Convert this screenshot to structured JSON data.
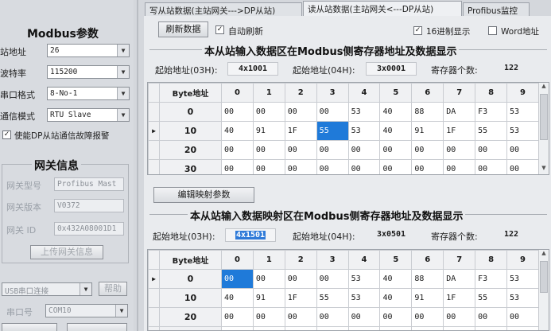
{
  "tabs": [
    {
      "label": "写从站数据(主站网关--->DP从站)"
    },
    {
      "label": "读从站数据(主站网关<---DP从站)"
    },
    {
      "label": "Profibus监控"
    }
  ],
  "modbus_params": {
    "title": "Modbus参数",
    "fields": [
      {
        "label": "站地址",
        "value": "26"
      },
      {
        "label": "波特率",
        "value": "115200"
      },
      {
        "label": "串口格式",
        "value": "8-No-1"
      },
      {
        "label": "通信模式",
        "value": "RTU Slave"
      }
    ],
    "alarm_checkbox": {
      "checked": true,
      "label": "使能DP从站通信故障报警"
    }
  },
  "gateway_info": {
    "title": "网关信息",
    "fields": [
      {
        "label": "网关型号",
        "value": "Profibus Mast"
      },
      {
        "label": "网关版本",
        "value": "V0372"
      },
      {
        "label": "网关 ID",
        "value": "0x432A08001D1"
      }
    ],
    "upload_button": "上传网关信息"
  },
  "connection": {
    "type_value": "USB串口连接",
    "help_button": "帮助",
    "port_label": "串口号",
    "port_value": "COM10"
  },
  "toolbar": {
    "refresh_button": "刷新数据",
    "auto_refresh": {
      "checked": true,
      "label": "自动刷新"
    },
    "hex_display": {
      "checked": true,
      "label": "16进制显示"
    },
    "word_address": {
      "checked": false,
      "label": "Word地址"
    }
  },
  "input_section": {
    "title": "本从站输入数据区在Modbus侧寄存器地址及数据显示",
    "start_03h_label": "起始地址(03H):",
    "start_03h_value": "4x1001",
    "start_04h_label": "起始地址(04H):",
    "start_04h_value": "3x0001",
    "reg_count_label": "寄存器个数:",
    "reg_count_value": "122",
    "grid": {
      "header": [
        "Byte地址",
        "0",
        "1",
        "2",
        "3",
        "4",
        "5",
        "6",
        "7",
        "8",
        "9"
      ],
      "rows": [
        {
          "addr": "0",
          "marker": "",
          "cells": [
            "00",
            "00",
            "00",
            "00",
            "53",
            "40",
            "88",
            "DA",
            "F3",
            "53"
          ]
        },
        {
          "addr": "10",
          "marker": "▶",
          "cells": [
            "40",
            "91",
            "1F",
            "55",
            "53",
            "40",
            "91",
            "1F",
            "55",
            "53"
          ]
        },
        {
          "addr": "20",
          "marker": "",
          "cells": [
            "00",
            "00",
            "00",
            "00",
            "00",
            "00",
            "00",
            "00",
            "00",
            "00"
          ]
        },
        {
          "addr": "30",
          "marker": "",
          "cells": [
            "00",
            "00",
            "00",
            "00",
            "00",
            "00",
            "00",
            "00",
            "00",
            "00"
          ]
        }
      ]
    }
  },
  "edit_mapping_button": "编辑映射参数",
  "mapping_section": {
    "title": "本从站输入数据映射区在Modbus侧寄存器地址及数据显示",
    "start_03h_label": "起始地址(03H):",
    "start_03h_value": "4x1501",
    "start_04h_label": "起始地址(04H):",
    "start_04h_value": "3x0501",
    "reg_count_label": "寄存器个数:",
    "reg_count_value": "122",
    "grid": {
      "header": [
        "Byte地址",
        "0",
        "1",
        "2",
        "3",
        "4",
        "5",
        "6",
        "7",
        "8",
        "9"
      ],
      "rows": [
        {
          "addr": "0",
          "marker": "▶",
          "cells": [
            "00",
            "00",
            "00",
            "00",
            "53",
            "40",
            "88",
            "DA",
            "F3",
            "53"
          ]
        },
        {
          "addr": "10",
          "marker": "",
          "cells": [
            "40",
            "91",
            "1F",
            "55",
            "53",
            "40",
            "91",
            "1F",
            "55",
            "53"
          ]
        },
        {
          "addr": "20",
          "marker": "",
          "cells": [
            "00",
            "00",
            "00",
            "00",
            "00",
            "00",
            "00",
            "00",
            "00",
            "00"
          ]
        },
        {
          "addr": "30",
          "marker": "",
          "cells": [
            "00",
            "00",
            "00",
            "00",
            "00",
            "00",
            "00",
            "00",
            "00",
            "00"
          ]
        }
      ]
    }
  },
  "colors": {
    "selection": "#1f7ad9",
    "window_bg": "#d4d7dc"
  }
}
